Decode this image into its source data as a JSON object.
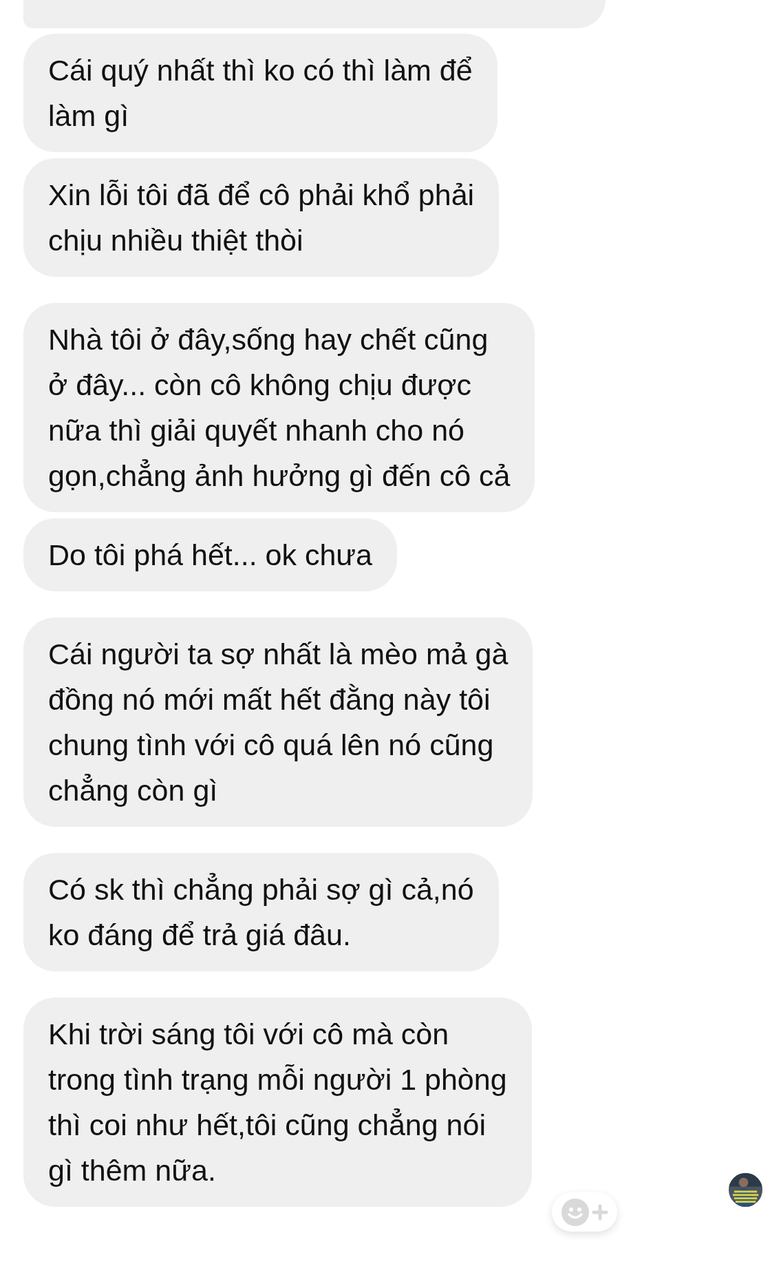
{
  "groups": [
    {
      "messages": [
        {
          "text": "Cái quý nhất thì ko có thì làm để\nlàm gì"
        },
        {
          "text": "Xin lỗi tôi đã để cô phải khổ phải\nchịu nhiều thiệt thòi"
        }
      ]
    },
    {
      "messages": [
        {
          "text": "Nhà tôi ở đây,sống hay chết cũng\nở đây... còn cô không chịu được\nnữa thì giải quyết nhanh cho nó\ngọn,chẳng ảnh hưởng gì đến cô cả"
        },
        {
          "text": "Do tôi phá hết... ok chưa"
        }
      ]
    },
    {
      "messages": [
        {
          "text": "Cái người ta sợ nhất là mèo mả gà\nđồng nó mới mất hết đằng này tôi\nchung tình với cô quá lên nó cũng\nchẳng còn gì"
        }
      ]
    },
    {
      "messages": [
        {
          "text": "Có sk thì chẳng phải sợ gì cả,nó\nko đáng để trả giá đâu."
        }
      ]
    },
    {
      "messages": [
        {
          "text": "Khi trời sáng tôi với cô mà còn\ntrong tình trạng mỗi người 1 phòng\nthì coi như hết,tôi cũng chẳng nói\ngì thêm nữa."
        }
      ]
    }
  ]
}
